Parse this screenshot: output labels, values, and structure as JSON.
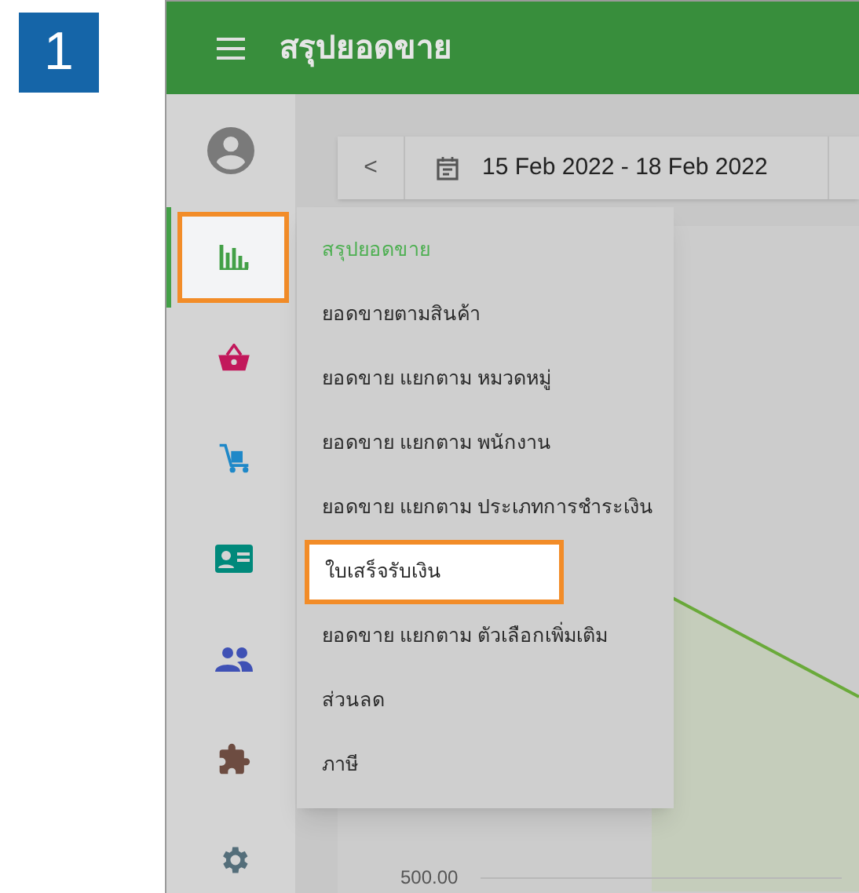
{
  "step_badge": "1",
  "app_bar": {
    "title": "สรุปยอดขาย"
  },
  "sidebar": {
    "items": [
      {
        "kind": "chart",
        "selected": true,
        "highlighted": true
      },
      {
        "kind": "basket",
        "selected": false,
        "highlighted": false
      },
      {
        "kind": "cart",
        "selected": false,
        "highlighted": false
      },
      {
        "kind": "idcard",
        "selected": false,
        "highlighted": false
      },
      {
        "kind": "people",
        "selected": false,
        "highlighted": false
      },
      {
        "kind": "puzzle",
        "selected": false,
        "highlighted": false
      },
      {
        "kind": "gear",
        "selected": false,
        "highlighted": false
      }
    ]
  },
  "date_bar": {
    "prev": "<",
    "range": "15 Feb 2022 - 18 Feb 2022"
  },
  "report_menu": {
    "items": [
      {
        "label": "สรุปยอดขาย",
        "selected": true,
        "highlighted": false
      },
      {
        "label": "ยอดขายตามสินค้า",
        "selected": false,
        "highlighted": false
      },
      {
        "label": "ยอดขาย แยกตาม หมวดหมู่",
        "selected": false,
        "highlighted": false
      },
      {
        "label": "ยอดขาย แยกตาม พนักงาน",
        "selected": false,
        "highlighted": false
      },
      {
        "label": "ยอดขาย แยกตาม ประเภทการชำระเงิน",
        "selected": false,
        "highlighted": false
      },
      {
        "label": "ใบเสร็จรับเงิน",
        "selected": false,
        "highlighted": true
      },
      {
        "label": "ยอดขาย แยกตาม ตัวเลือกเพิ่มเติม",
        "selected": false,
        "highlighted": false
      },
      {
        "label": "ส่วนลด",
        "selected": false,
        "highlighted": false
      },
      {
        "label": "ภาษี",
        "selected": false,
        "highlighted": false
      }
    ]
  },
  "chart": {
    "y_tick": "500.00"
  }
}
